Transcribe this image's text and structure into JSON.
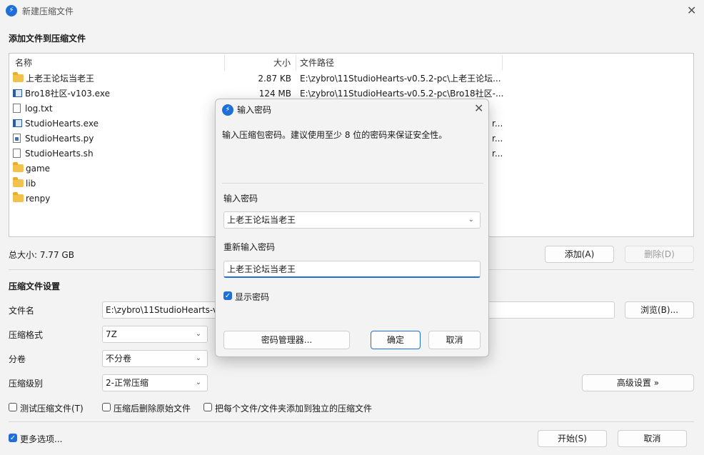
{
  "window": {
    "title": "新建压缩文件",
    "close_glyph": "✕"
  },
  "add_section": {
    "title": "添加文件到压缩文件"
  },
  "file_list": {
    "columns": [
      "名称",
      "大小",
      "文件路径"
    ],
    "rows": [
      {
        "icon": "folder-icon",
        "name": "上老王论坛当老王",
        "size": "2.87 KB",
        "path": "E:\\zybro\\11StudioHearts-v0.5.2-pc\\上老王论坛..."
      },
      {
        "icon": "exe-icon",
        "name": "Bro18社区-v103.exe",
        "size": "124 MB",
        "path": "E:\\zybro\\11StudioHearts-v0.5.2-pc\\Bro18社区-..."
      },
      {
        "icon": "text-file-icon",
        "name": "log.txt",
        "size": "",
        "path": ""
      },
      {
        "icon": "exe-icon",
        "name": "StudioHearts.exe",
        "size": "",
        "path": "r..."
      },
      {
        "icon": "python-file-icon",
        "name": "StudioHearts.py",
        "size": "",
        "path": "r..."
      },
      {
        "icon": "text-file-icon",
        "name": "StudioHearts.sh",
        "size": "",
        "path": "r..."
      },
      {
        "icon": "folder-icon",
        "name": "game",
        "size": "",
        "path": ""
      },
      {
        "icon": "folder-icon",
        "name": "lib",
        "size": "",
        "path": ""
      },
      {
        "icon": "folder-icon",
        "name": "renpy",
        "size": "",
        "path": ""
      }
    ]
  },
  "total_size": "总大小: 7.77 GB",
  "buttons": {
    "add": "添加(A)",
    "remove": "删除(D)",
    "browse": "浏览(B)...",
    "advanced": "高级设置 »",
    "start": "开始(S)",
    "cancel": "取消"
  },
  "settings": {
    "title": "压缩文件设置",
    "filename_label": "文件名",
    "filename_value": "E:\\zybro\\11StudioHearts-v",
    "format_label": "压缩格式",
    "format_value": "7Z",
    "split_label": "分卷",
    "split_value": "不分卷",
    "level_label": "压缩级别",
    "level_value": "2-正常压缩"
  },
  "options": {
    "test": "测试压缩文件(T)",
    "delete_after": "压缩后删除原始文件",
    "separate": "把每个文件/文件夹添加到独立的压缩文件",
    "more": "更多选项..."
  },
  "dialog": {
    "title": "输入密码",
    "description": "输入压缩包密码。建议使用至少 8 位的密码来保证安全性。",
    "password_label": "输入密码",
    "password_value": "上老王论坛当老王",
    "reenter_label": "重新输入密码",
    "reenter_value": "上老王论坛当老王",
    "show_password": "显示密码",
    "manager_button": "密码管理器...",
    "ok_button": "确定",
    "cancel_button": "取消"
  }
}
